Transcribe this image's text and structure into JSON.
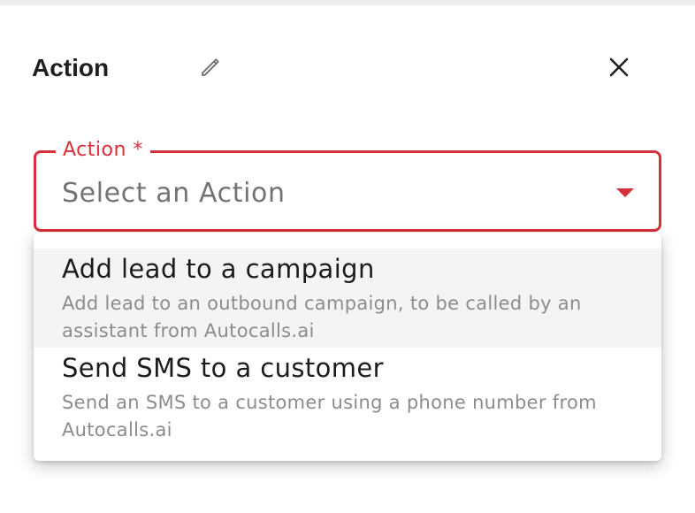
{
  "header": {
    "title": "Action",
    "edit_icon": "pencil-icon",
    "close_icon": "close-icon"
  },
  "action_select": {
    "label": "Action *",
    "placeholder": "Select an Action",
    "caret_icon": "caret-down-icon",
    "accent_color": "#d6313b"
  },
  "dropdown": {
    "items": [
      {
        "title": "Add lead to a campaign",
        "description": "Add lead to an outbound campaign, to be called by an assistant from Autocalls.ai",
        "highlighted": true
      },
      {
        "title": "Send SMS to a customer",
        "description": "Send an SMS to a customer using a phone number from Autocalls.ai",
        "highlighted": false
      }
    ]
  }
}
